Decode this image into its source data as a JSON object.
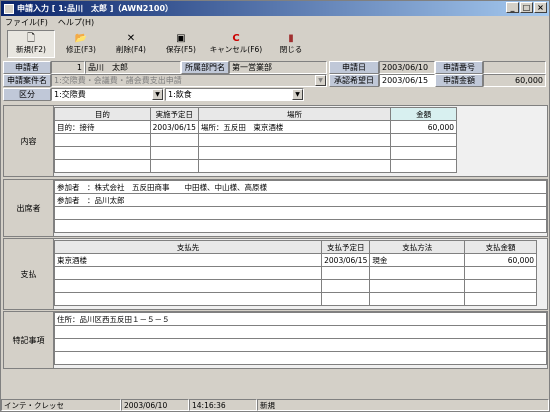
{
  "window": {
    "title": "申請入力 [ 1:品川　太郎 ]（AWN2100）",
    "btn_min": "_",
    "btn_max": "□",
    "btn_close": "×"
  },
  "menu": [
    "ファイル(F)",
    "ヘルプ(H)"
  ],
  "toolbar": [
    {
      "label": "新規(F2)",
      "icon": "new-document-icon",
      "glyph": "🗋"
    },
    {
      "label": "修正(F3)",
      "icon": "open-folder-icon",
      "glyph": "📂"
    },
    {
      "label": "削除(F4)",
      "icon": "delete-x-icon",
      "glyph": "✕"
    },
    {
      "label": "保存(F5)",
      "icon": "save-disk-icon",
      "glyph": "▣"
    },
    {
      "label": "キャンセル(F6)",
      "icon": "cancel-icon",
      "glyph": "C"
    },
    {
      "label": "閉じる",
      "icon": "close-door-icon",
      "glyph": "▮"
    }
  ],
  "header": {
    "applicant_label": "申請者",
    "applicant_no": "1",
    "applicant_name": "品川　太郎",
    "dept_label": "所属部門名",
    "dept_value": "第一営業部",
    "apply_date_label": "申請日",
    "apply_date": "2003/06/10",
    "apply_no_label": "申請番号",
    "apply_no": "",
    "case_label": "申請案件名",
    "case_value": "1:交際費・会議費・諸会費支出申請",
    "approval_label": "承認希望日",
    "approval_date": "2003/06/15",
    "amount_label": "申請金額",
    "amount": "60,000",
    "category_label": "区分",
    "category_value": "1:交際費",
    "subcategory_value": "1:飲食"
  },
  "content": {
    "label": "内容",
    "headers": {
      "purpose": "目的",
      "date": "実施予定日",
      "place": "場所",
      "amount": "金額"
    },
    "rows": [
      {
        "purpose": "目的：接待",
        "date": "2003/06/15",
        "place": "場所：五反田　東京酒楼",
        "amount": "60,000"
      },
      {
        "purpose": "",
        "date": "",
        "place": "",
        "amount": ""
      },
      {
        "purpose": "",
        "date": "",
        "place": "",
        "amount": ""
      },
      {
        "purpose": "",
        "date": "",
        "place": "",
        "amount": ""
      }
    ]
  },
  "attendees": {
    "label": "出席者",
    "lines": [
      "参加者　：株式会社　五反田商事　　中田様、中山様、高原様",
      "参加者　：品川太郎",
      "",
      "",
      ""
    ]
  },
  "payment": {
    "label": "支払",
    "headers": {
      "payee": "支払先",
      "date": "支払予定日",
      "method": "支払方法",
      "amount": "支払金額"
    },
    "rows": [
      {
        "payee": "東京酒楼",
        "date": "2003/06/15",
        "method": "現金",
        "amount": "60,000"
      },
      {
        "payee": "",
        "date": "",
        "method": "",
        "amount": ""
      },
      {
        "payee": "",
        "date": "",
        "method": "",
        "amount": ""
      },
      {
        "payee": "",
        "date": "",
        "method": "",
        "amount": ""
      }
    ]
  },
  "notes": {
    "label": "特記事項",
    "lines": [
      "住所：品川区西五反田１－５－５",
      "",
      "",
      ""
    ]
  },
  "status": {
    "user": "インテ・クレッセ",
    "date": "2003/06/10",
    "time": "14:16:36",
    "mode": "新規"
  }
}
